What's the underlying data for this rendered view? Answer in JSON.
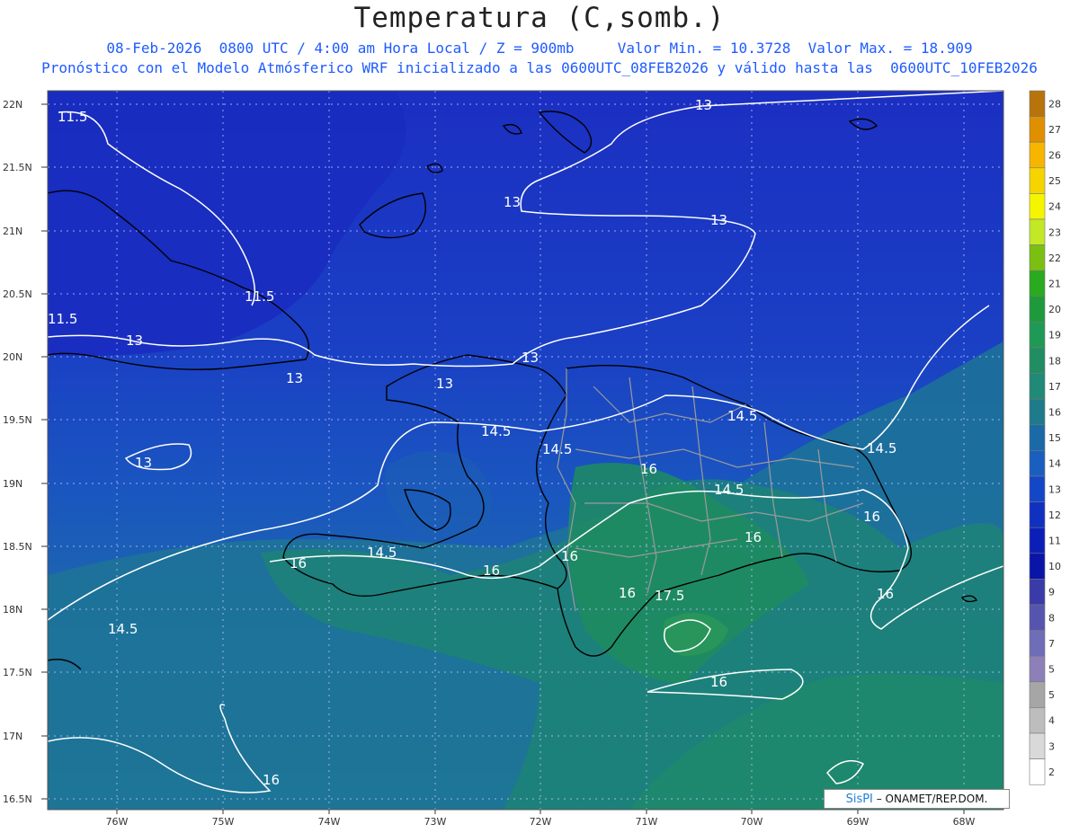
{
  "title": "Temperatura (C,somb.)",
  "subtitle_line1": "08-Feb-2026  0800 UTC / 4:00 am Hora Local / Z = 900mb     Valor Min. = 10.3728  Valor Max. = 18.909",
  "subtitle_line2": "Pronóstico con el Modelo Atmósferico WRF inicializado a las 0600UTC_08FEB2026 y válido hasta las  0600UTC_10FEB2026",
  "latitude_labels": [
    "22N",
    "21.5N",
    "21N",
    "20.5N",
    "20N",
    "19.5N",
    "19N",
    "18.5N",
    "18N",
    "17.5N",
    "17N",
    "16.5N"
  ],
  "longitude_labels": [
    "76W",
    "75W",
    "74W",
    "73W",
    "72W",
    "71W",
    "70W",
    "69W",
    "68W"
  ],
  "colorbar_levels": [
    "28",
    "27",
    "26",
    "25",
    "24",
    "23",
    "22",
    "21",
    "20",
    "19",
    "18",
    "17",
    "16",
    "15",
    "14",
    "13",
    "12",
    "11",
    "10",
    "9",
    "8",
    "7",
    "5",
    "5",
    "4",
    "3",
    "2"
  ],
  "colorbar_colors": [
    "#b8740a",
    "#e08f00",
    "#f7b500",
    "#f5d400",
    "#f5f500",
    "#c2e826",
    "#7bbf12",
    "#2aaa1e",
    "#1e9a3c",
    "#1f9a56",
    "#208e62",
    "#1f8a75",
    "#1d7b8b",
    "#1a6aa8",
    "#1a5fc0",
    "#1446c8",
    "#1030c0",
    "#0b1fb8",
    "#0a14a8",
    "#3a3aa8",
    "#5555b0",
    "#6e6eb8",
    "#8d80b8",
    "#a6a6a6",
    "#bdbdbd",
    "#d9d9d9",
    "#ffffff"
  ],
  "contour_labels": [
    "11.5",
    "11.5",
    "11.5",
    "13",
    "13",
    "13",
    "13",
    "13",
    "13",
    "13",
    "13",
    "14.5",
    "14.5",
    "14.5",
    "14.5",
    "14.5",
    "14.5",
    "14.5",
    "16",
    "16",
    "16",
    "16",
    "16",
    "16",
    "16",
    "16",
    "16",
    "16",
    "17.5"
  ],
  "credit_brand": "SisPI",
  "credit_text": " – ONAMET/REP.DOM.",
  "field_colors": {
    "cold": "#1b2fc2",
    "mid": "#1a55c0",
    "warm": "#1f7aa8",
    "warmest": "#1e8a6e",
    "contour": "#ffffff",
    "border": "#999999",
    "coast": "#000000"
  }
}
